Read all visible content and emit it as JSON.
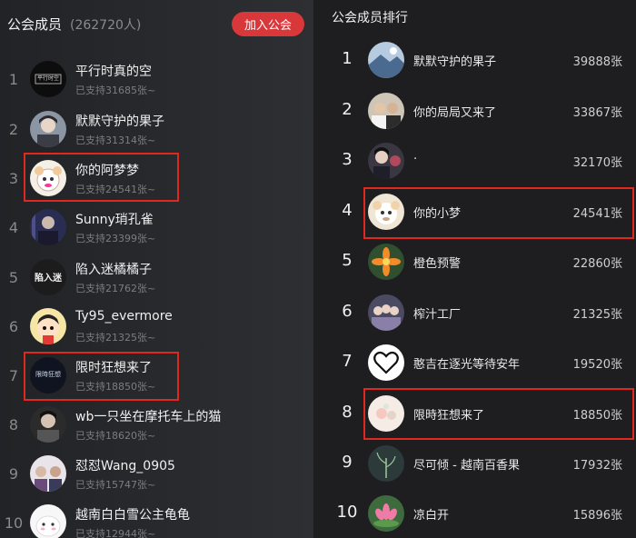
{
  "left": {
    "title": "公会成员",
    "member_count": "(262720人)",
    "join_button": "加入公会",
    "members": [
      {
        "rank": "1",
        "name": "平行时真的空",
        "support": "已支持31685张~",
        "avatar": "logo-avatar",
        "avatar_text": "平行时空"
      },
      {
        "rank": "2",
        "name": "默默守护的果子",
        "support": "已支持31314张~",
        "avatar": "person-avatar"
      },
      {
        "rank": "3",
        "name": "你的阿梦梦",
        "support": "已支持24541张~",
        "avatar": "cartoon-sheep-avatar"
      },
      {
        "rank": "4",
        "name": "Sunny琑孔雀",
        "support": "已支持23399张~",
        "avatar": "person-dark-avatar"
      },
      {
        "rank": "5",
        "name": "陷入迷橘橘子",
        "support": "已支持21762张~",
        "avatar": "text-art-avatar",
        "avatar_text": "陷入迷"
      },
      {
        "rank": "6",
        "name": "Ty95_evermore",
        "support": "已支持21325张~",
        "avatar": "cartoon-boy-avatar"
      },
      {
        "rank": "7",
        "name": "限时狂想来了",
        "support": "已支持18850张~",
        "avatar": "text-logo-avatar",
        "avatar_text": "限時狂想"
      },
      {
        "rank": "8",
        "name": "wb一只坐在摩托车上的猫",
        "support": "已支持18620张~",
        "avatar": "person-avatar"
      },
      {
        "rank": "9",
        "name": "怼怼Wang_0905",
        "support": "已支持15747张~",
        "avatar": "group-avatar"
      },
      {
        "rank": "10",
        "name": "越南白白雪公主龟龟",
        "support": "已支持12944张~",
        "avatar": "cartoon-white-avatar"
      }
    ]
  },
  "right": {
    "title": "公会成员排行",
    "members": [
      {
        "rank": "1",
        "name": "默默守护的果子",
        "count": "39888张",
        "avatar": "landscape-avatar"
      },
      {
        "rank": "2",
        "name": "你的局局又来了",
        "count": "33867张",
        "avatar": "group-avatar"
      },
      {
        "rank": "3",
        "name": "·",
        "count": "32170张",
        "avatar": "person-avatar"
      },
      {
        "rank": "4",
        "name": "你的小梦",
        "count": "24541张",
        "avatar": "cartoon-sheep-avatar"
      },
      {
        "rank": "5",
        "name": "橙色预警",
        "count": "22860张",
        "avatar": "flower-avatar"
      },
      {
        "rank": "6",
        "name": "榨汁工厂",
        "count": "21325张",
        "avatar": "group-avatar"
      },
      {
        "rank": "7",
        "name": "憨吉在逐光等待安年",
        "count": "19520张",
        "avatar": "heart-outline-avatar"
      },
      {
        "rank": "8",
        "name": "限時狂想来了",
        "count": "18850张",
        "avatar": "pastel-avatar"
      },
      {
        "rank": "9",
        "name": "尽可倾 - 越南百香果",
        "count": "17932张",
        "avatar": "plant-avatar"
      },
      {
        "rank": "10",
        "name": "凉白开",
        "count": "15896张",
        "avatar": "lotus-avatar"
      }
    ]
  },
  "colors": {
    "accent": "#d9383a",
    "highlight": "#e0281e"
  }
}
